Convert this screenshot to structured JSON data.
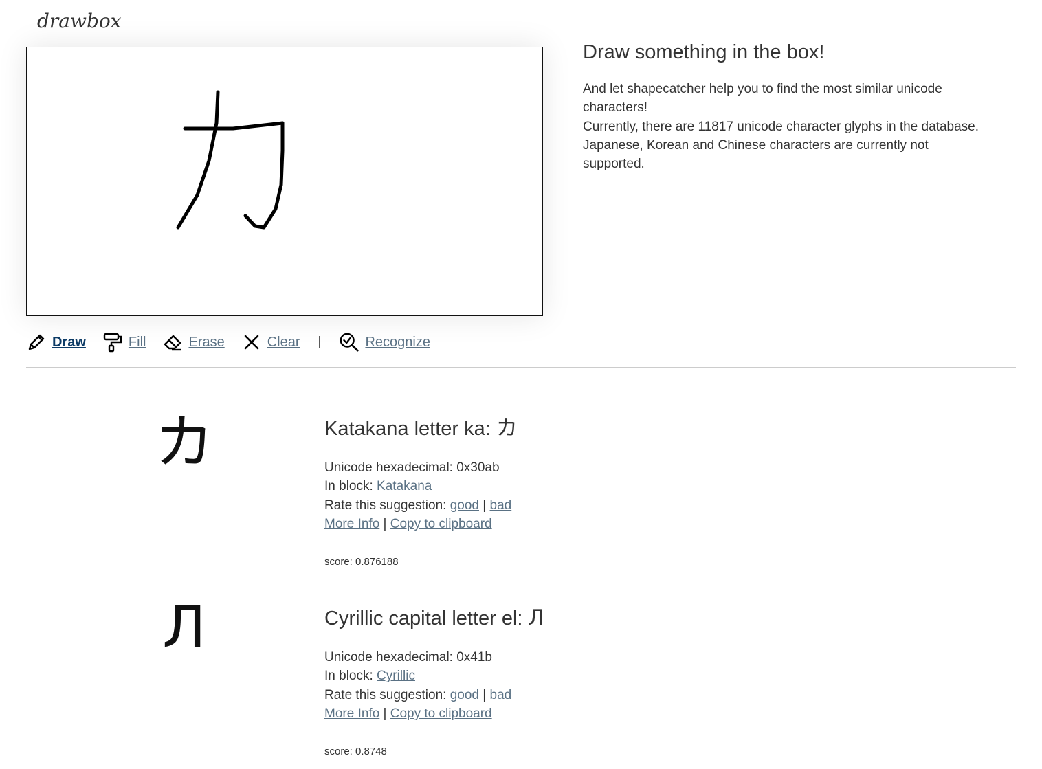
{
  "logo": {
    "text": "drawbox"
  },
  "intro": {
    "heading": "Draw something in the box!",
    "line1": "And let shapecatcher help you to find the most similar unicode",
    "line2": "characters!",
    "line3": "Currently, there are 11817 unicode character glyphs in the database.",
    "line4": "Japanese, Korean and Chinese characters are currently not",
    "line5": "supported."
  },
  "toolbar": {
    "draw_label": "Draw",
    "fill_label": "Fill",
    "erase_label": "Erase",
    "clear_label": "Clear",
    "separator": "|",
    "recognize_label": "Recognize",
    "active_tool": "draw"
  },
  "labels": {
    "unicode_hex": "Unicode hexadecimal: ",
    "in_block": "In block: ",
    "rate": "Rate this suggestion: ",
    "good": "good",
    "bad": "bad",
    "pipe": " | ",
    "more_info": "More Info",
    "copy": "Copy to clipboard",
    "score": "score: "
  },
  "results": [
    {
      "name": "Katakana letter ka: ",
      "char": "カ",
      "hex": "0x30ab",
      "block": "Katakana",
      "score": "0.876188"
    },
    {
      "name": "Cyrillic capital letter el: ",
      "char": "Л",
      "hex": "0x41b",
      "block": "Cyrillic",
      "score": "0.8748"
    }
  ],
  "colors": {
    "link": "#5a7184",
    "active_link": "#0d3b66",
    "text": "#333333",
    "divider": "#cccccc"
  }
}
